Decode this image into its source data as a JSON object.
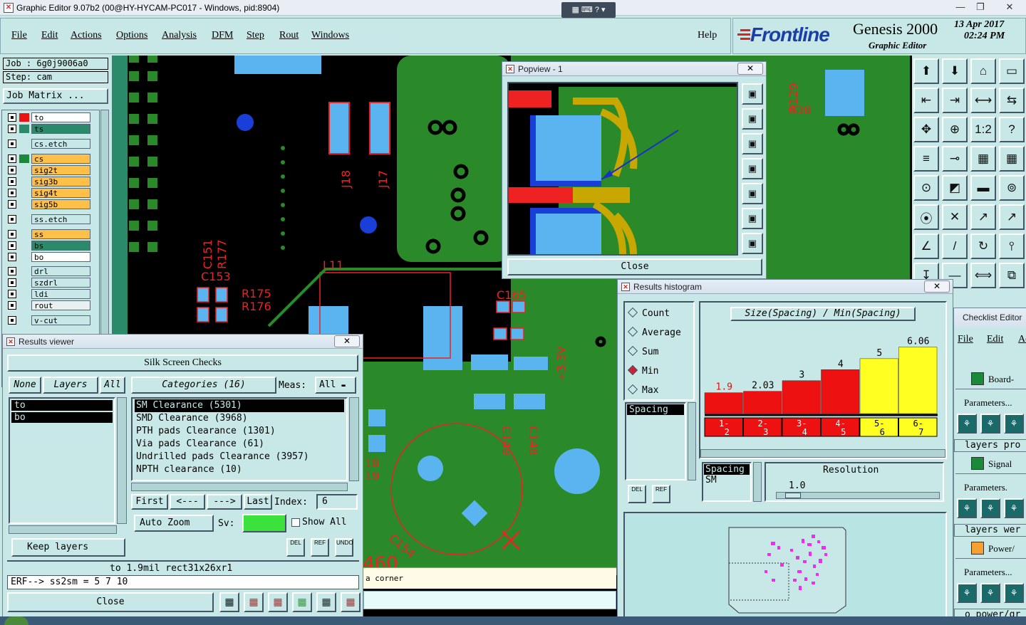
{
  "window": {
    "title": "Graphic Editor 9.07b2 (00@HY-HYCAM-PC017 - Windows, pid:8904)",
    "min": "—",
    "max": "❐",
    "close": "✕"
  },
  "menu": [
    "File",
    "Edit",
    "Actions",
    "Options",
    "Analysis",
    "DFM",
    "Step",
    "Rout",
    "Windows"
  ],
  "help": "Help",
  "brand": {
    "logo": "Frontline",
    "product": "Genesis 2000",
    "subtitle": "Graphic Editor",
    "date": "13 Apr 2017",
    "time": "02:24 PM"
  },
  "job": {
    "job_line": "Job : 6g0j9006a0",
    "step_line": "Step: cam",
    "matrix_btn": "Job Matrix ..."
  },
  "layers": [
    {
      "name": "to",
      "color": "#ffffff",
      "tag": "#e11"
    },
    {
      "name": "ts",
      "color": "#2a8a6a",
      "tag": "#2a8a6a"
    },
    {
      "name": "cs.etch",
      "color": "#c8e8e8",
      "tag": ""
    },
    {
      "name": "cs",
      "color": "#ffc04a",
      "tag": "#1a8a3a"
    },
    {
      "name": "sig2t",
      "color": "#ffc04a",
      "tag": ""
    },
    {
      "name": "sig3b",
      "color": "#ffc04a",
      "tag": ""
    },
    {
      "name": "sig4t",
      "color": "#ffc04a",
      "tag": ""
    },
    {
      "name": "sig5b",
      "color": "#ffc04a",
      "tag": ""
    },
    {
      "name": "ss.etch",
      "color": "#c8e8e8",
      "tag": ""
    },
    {
      "name": "ss",
      "color": "#ffc04a",
      "tag": ""
    },
    {
      "name": "bs",
      "color": "#2a8a6a",
      "tag": ""
    },
    {
      "name": "bo",
      "color": "#ffffff",
      "tag": ""
    },
    {
      "name": "drl",
      "color": "#c8e8e8",
      "tag": ""
    },
    {
      "name": "szdrl",
      "color": "#c8e8e8",
      "tag": ""
    },
    {
      "name": "ldi",
      "color": "#c8e8e8",
      "tag": ""
    },
    {
      "name": "rout",
      "color": "#e8f0f0",
      "tag": ""
    },
    {
      "name": "v-cut",
      "color": "#c8e8e8",
      "tag": ""
    }
  ],
  "canvas_labels": {
    "j18": "J18",
    "j17": "J17",
    "r177": "R177",
    "c151": "C151",
    "c153": "C153",
    "r175": "R175",
    "r176": "R176",
    "l11": "L11",
    "c165": "C165",
    "c149": "C149",
    "c148": "C148",
    "v33": "+3.3V",
    "c154": "C154",
    "r129": "R129",
    "b38": "B38",
    "n18": "18",
    "n19": "19",
    "n460": "460"
  },
  "popview": {
    "title": "Popview - 1",
    "close": "Close"
  },
  "results_viewer": {
    "title": "Results viewer",
    "header": "Silk Screen Checks",
    "none": "None",
    "layers": "Layers",
    "all": "All",
    "categories": "Categories (16)",
    "meas_label": "Meas:",
    "meas_value": "All",
    "layer_list": [
      "to",
      "bo"
    ],
    "category_list": [
      "SM Clearance (5301)",
      "SMD Clearance (3968)",
      "PTH pads Clearance (1301)",
      "Via pads Clearance (61)",
      "Undrilled pads Clearance (3957)",
      "NPTH clearance (10)"
    ],
    "first": "First",
    "prev": "<---",
    "next": "--->",
    "last": "Last",
    "index_label": "Index:",
    "index_value": "6",
    "auto_zoom": "Auto Zoom",
    "sv": "Sv:",
    "show_all": "Show All",
    "keep_layers": "Keep layers",
    "del": "DEL",
    "ref": "REF",
    "undo": "UNDO",
    "result_line": "to 1.9mil  rect31x26xr1",
    "erf_line": "ERF--> ss2sm = 5 7 10",
    "close": "Close"
  },
  "histogram": {
    "title": "Results histogram",
    "radios": [
      "Count",
      "Average",
      "Sum",
      "Min",
      "Max"
    ],
    "selected": "Min",
    "chart_title": "Size(Spacing) / Min(Spacing)",
    "spacing_list": [
      "Spacing"
    ],
    "spacing_box": [
      "Spacing",
      "SM"
    ],
    "resolution_label": "Resolution",
    "resolution_value": "1.0",
    "del": "DEL",
    "ref": "REF"
  },
  "chart_data": {
    "type": "bar",
    "title": "Size(Spacing) / Min(Spacing)",
    "categories": [
      "1-2",
      "2-3",
      "3-4",
      "4-5",
      "5-6",
      "6-7"
    ],
    "category_labels": [
      [
        "1-",
        "2"
      ],
      [
        "2-",
        "3"
      ],
      [
        "3-",
        "4"
      ],
      [
        "4-",
        "5"
      ],
      [
        "5-",
        "6"
      ],
      [
        "6-",
        "7"
      ]
    ],
    "values": [
      1.9,
      2.03,
      3,
      4,
      5,
      6.06
    ],
    "value_labels": [
      "1.9",
      "2.03",
      "3",
      "4",
      "5",
      "6.06"
    ],
    "colors": [
      "#ee1111",
      "#ee1111",
      "#ee1111",
      "#ee1111",
      "#ffff22",
      "#ffff22"
    ],
    "ylim": [
      0,
      7
    ]
  },
  "status": {
    "corner_text": "a corner"
  },
  "checklist": {
    "title": "Checklist Editor",
    "menu": [
      "File",
      "Edit",
      "Actio"
    ],
    "items": [
      {
        "label": "Board-",
        "params": "Parameters...",
        "sub": "layers pro"
      },
      {
        "label": "Signal",
        "params": "Parameters.",
        "sub": "layers wer"
      },
      {
        "label": "Power/",
        "params": "Parameters...",
        "sub": "o power/gr"
      }
    ]
  },
  "right_tools": [
    "⬆",
    "⬇",
    "⌂",
    "▭",
    "⇤",
    "⇥",
    "⟷",
    "⇆",
    "✥",
    "⊕",
    "1:2",
    "?",
    "≡",
    "⊸",
    "▦",
    "▦",
    "⊙",
    "◩",
    "▬",
    "⊚",
    "⦿",
    "✕",
    "↗",
    "↗",
    "∠",
    "/",
    "↻",
    "⫯",
    "↧",
    "—",
    "⟺",
    "⧉"
  ]
}
